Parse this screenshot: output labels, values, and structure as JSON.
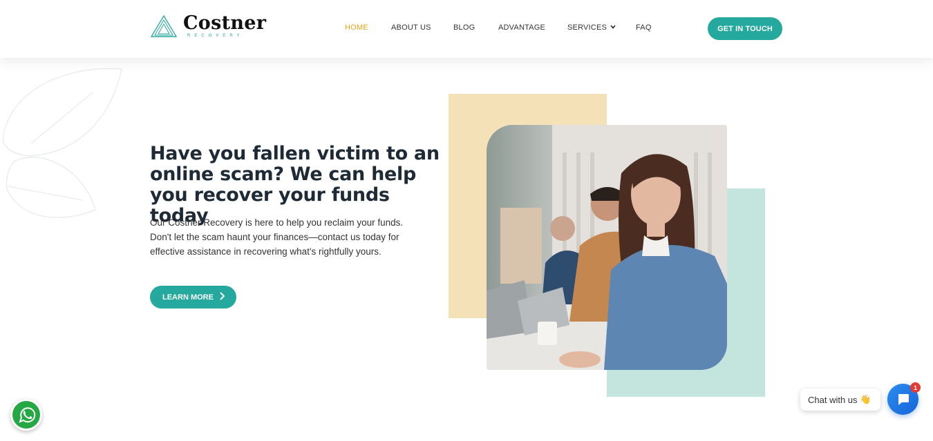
{
  "brand": {
    "name": "Costner",
    "tagline": "RECOVERY"
  },
  "nav": {
    "items": [
      {
        "label": "HOME",
        "active": true
      },
      {
        "label": "ABOUT US",
        "active": false
      },
      {
        "label": "BLOG",
        "active": false
      },
      {
        "label": "ADVANTAGE",
        "active": false
      },
      {
        "label": "SERVICES",
        "active": false,
        "has_dropdown": true
      },
      {
        "label": "FAQ",
        "active": false
      }
    ],
    "cta_label": "GET IN TOUCH"
  },
  "hero": {
    "title": "Have you fallen victim to an online scam? We can help you recover your funds today",
    "description": "Our Costner Recovery is here to help you reclaim your funds. Don't let the scam haunt your finances—contact us today for effective assistance in recovering what's rightfully yours.",
    "button_label": "LEARN MORE"
  },
  "widgets": {
    "chat_prompt": "Chat with us",
    "chat_emoji": "👋",
    "unread_count": "1"
  },
  "colors": {
    "accent": "#25a99e",
    "nav_active": "#e8a317",
    "beige_block": "#f5e1b8",
    "mint_block": "#c4e5de",
    "chat_blue": "#1565d8",
    "badge_red": "#e53935"
  }
}
